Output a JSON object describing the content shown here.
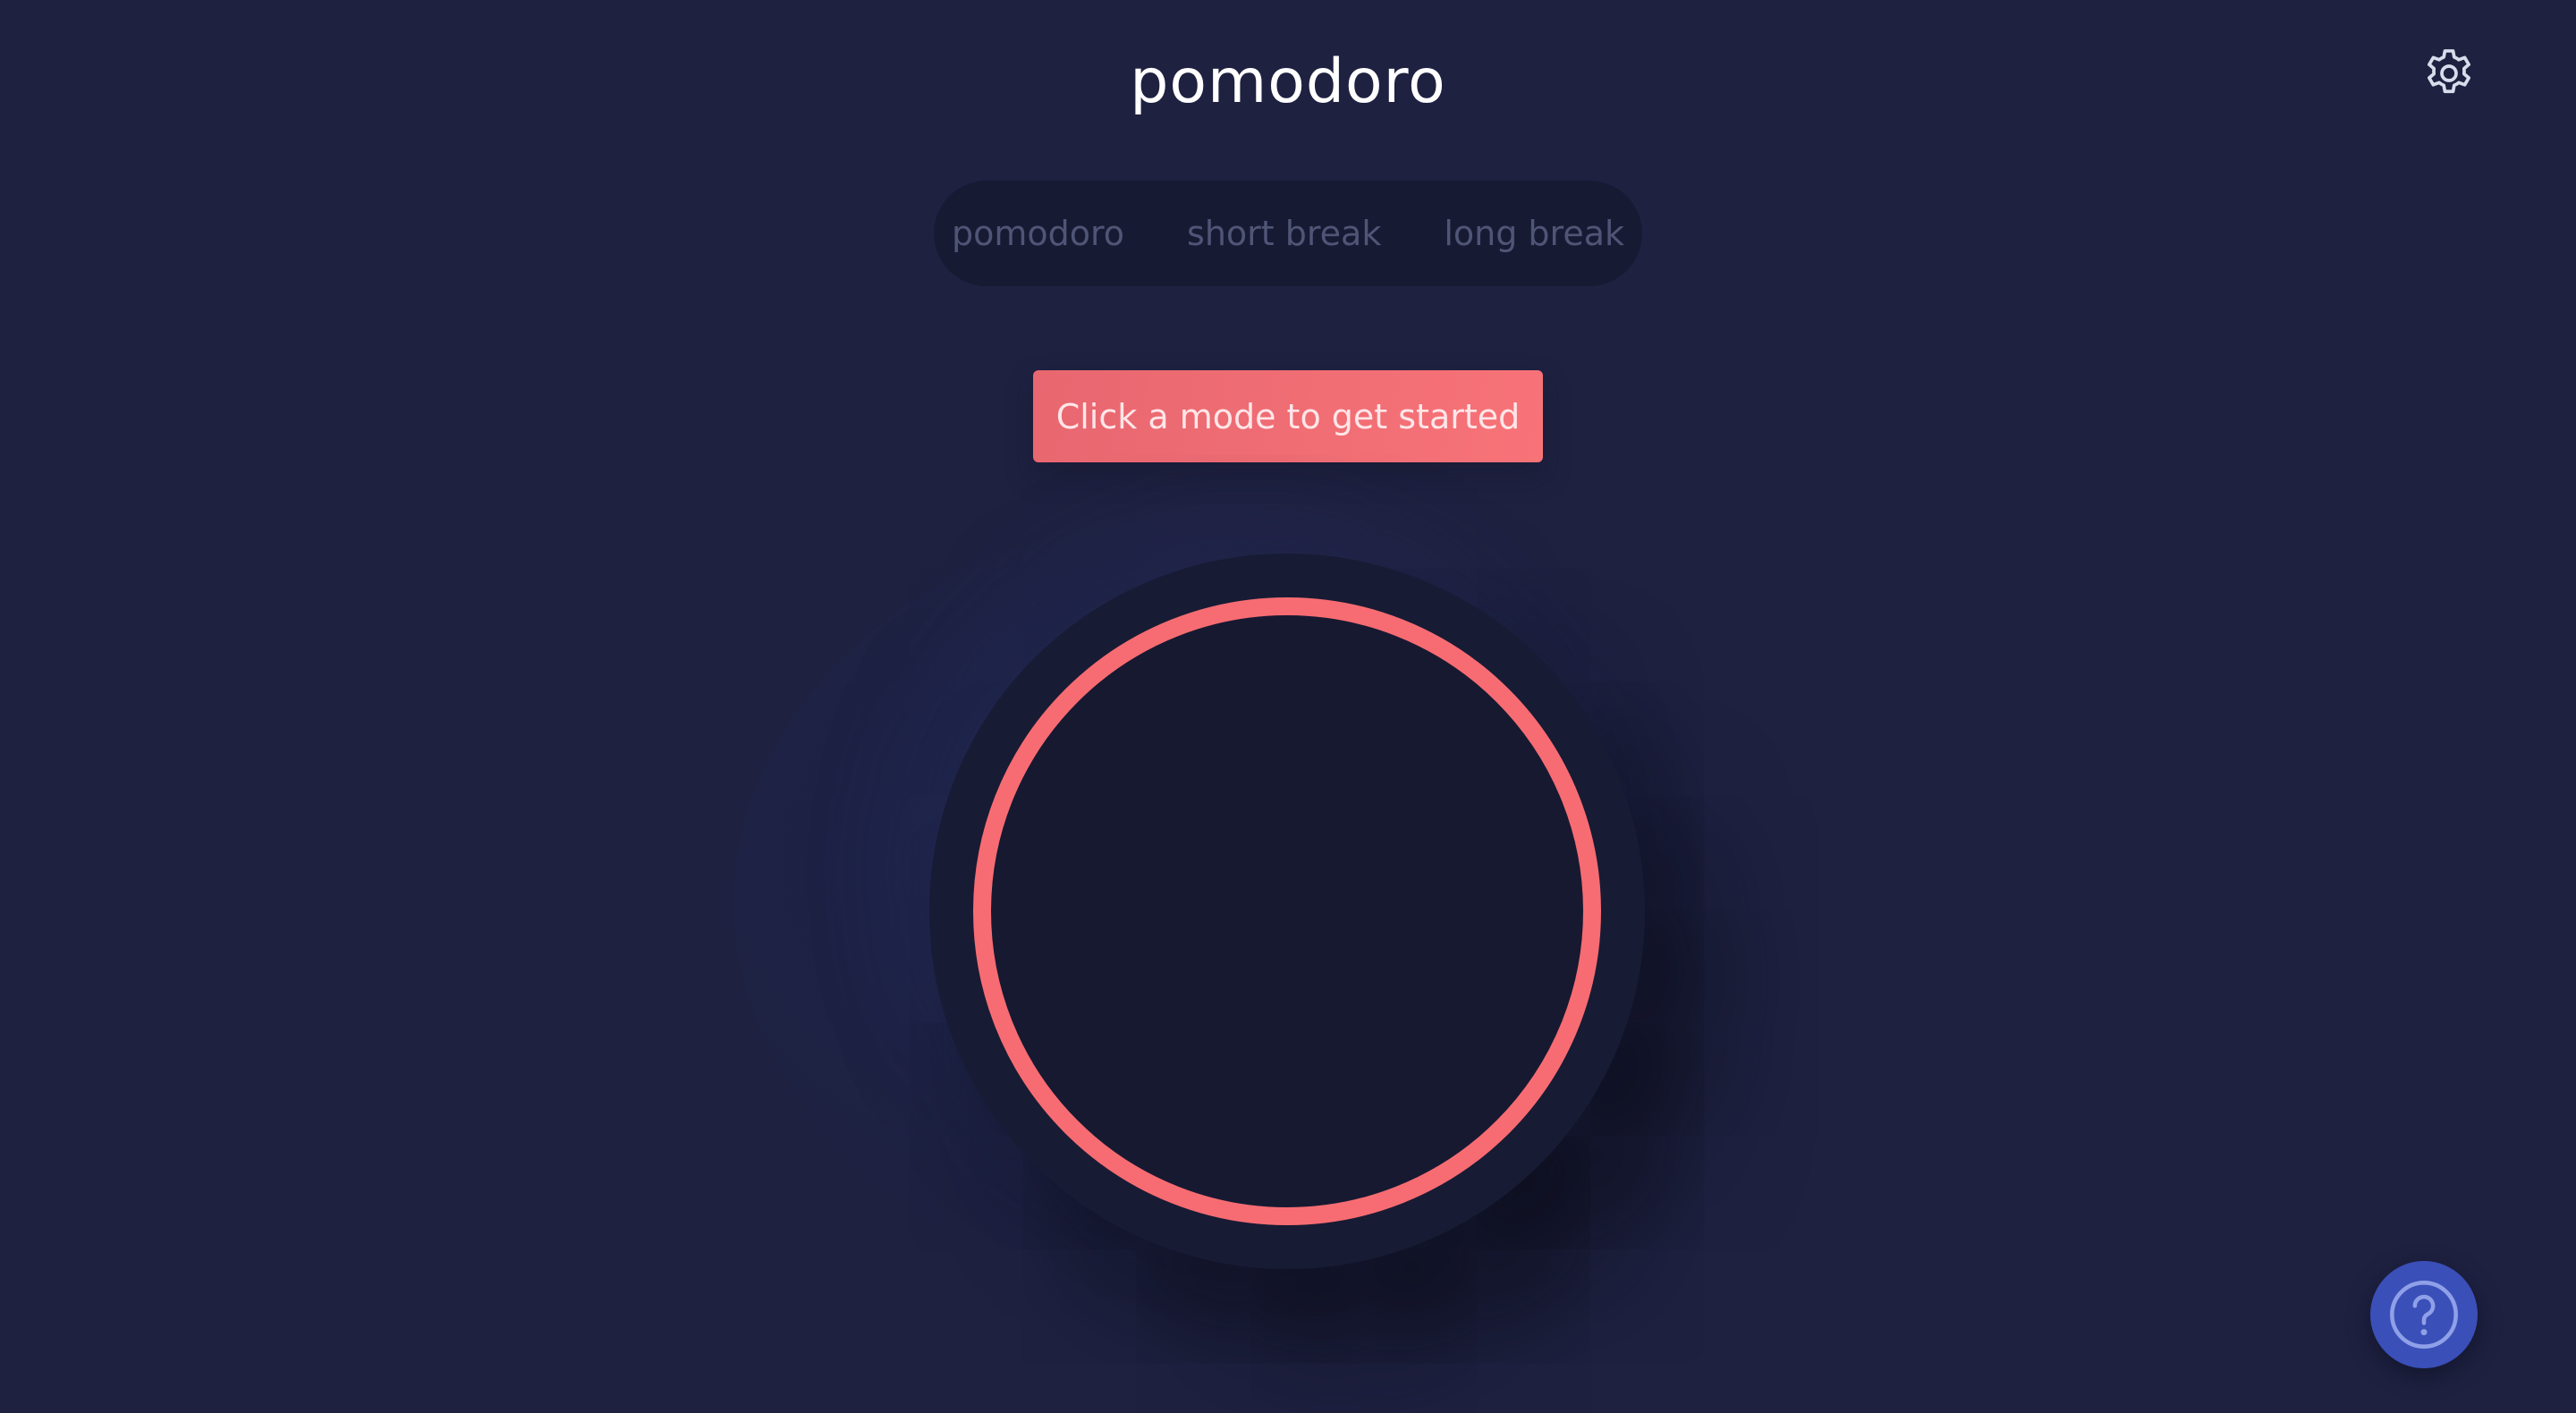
{
  "app": {
    "title": "pomodoro"
  },
  "modes": [
    {
      "label": "pomodoro"
    },
    {
      "label": "short break"
    },
    {
      "label": "long break"
    }
  ],
  "start_prompt": {
    "label": "Click a mode to get started"
  },
  "icons": {
    "settings": "gear-icon",
    "help": "question-mark-icon"
  },
  "colors": {
    "background": "#1e2140",
    "accent": "#f76c72",
    "help_button": "#3a4fb8",
    "mode_bar": "#171a33"
  },
  "timer": {
    "progress": 1.0
  }
}
